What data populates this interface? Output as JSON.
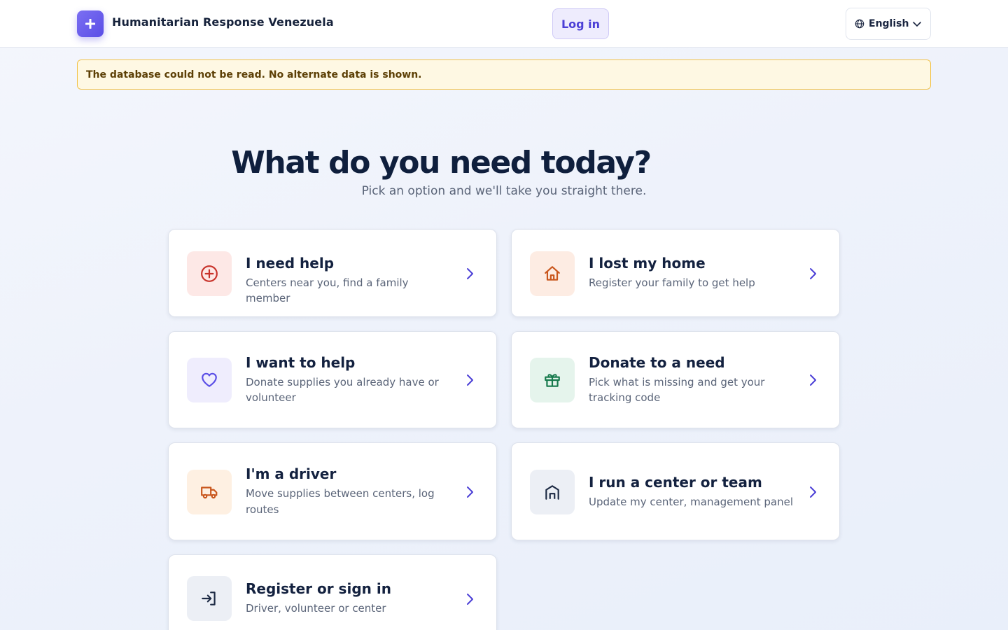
{
  "header": {
    "brand_name": "Humanitarian Response Venezuela",
    "login_label": "Log in",
    "language": "English"
  },
  "alert": {
    "message": "The database could not be read. No alternate data is shown."
  },
  "hero": {
    "title": "What do you need today?",
    "subtitle": "Pick an option and we'll take you straight there."
  },
  "options": [
    {
      "title": "I need help",
      "desc": "Centers near you, find a family member",
      "icon": "plus-circle-icon",
      "tint": "#fde8e6",
      "color": "#c8322a"
    },
    {
      "title": "I lost my home",
      "desc": "Register your family to get help",
      "icon": "home-icon",
      "tint": "#fdece3",
      "color": "#c9561c"
    },
    {
      "title": "I want to help",
      "desc": "Donate supplies you already have or volunteer",
      "icon": "heart-icon",
      "tint": "#efedfd",
      "color": "#5a4ee6"
    },
    {
      "title": "Donate to a need",
      "desc": "Pick what is missing and get your tracking code",
      "icon": "gift-icon",
      "tint": "#e5f4ec",
      "color": "#177a4d"
    },
    {
      "title": "I'm a driver",
      "desc": "Move supplies between centers, log routes",
      "icon": "truck-icon",
      "tint": "#fef0e2",
      "color": "#c9561c"
    },
    {
      "title": "I run a center or team",
      "desc": "Update my center, management panel",
      "icon": "building-icon",
      "tint": "#eceff5",
      "color": "#1d2a44"
    },
    {
      "title": "Register or sign in",
      "desc": "Driver, volunteer or center",
      "icon": "sign-in-icon",
      "tint": "#eceff5",
      "color": "#1d2a44"
    }
  ]
}
